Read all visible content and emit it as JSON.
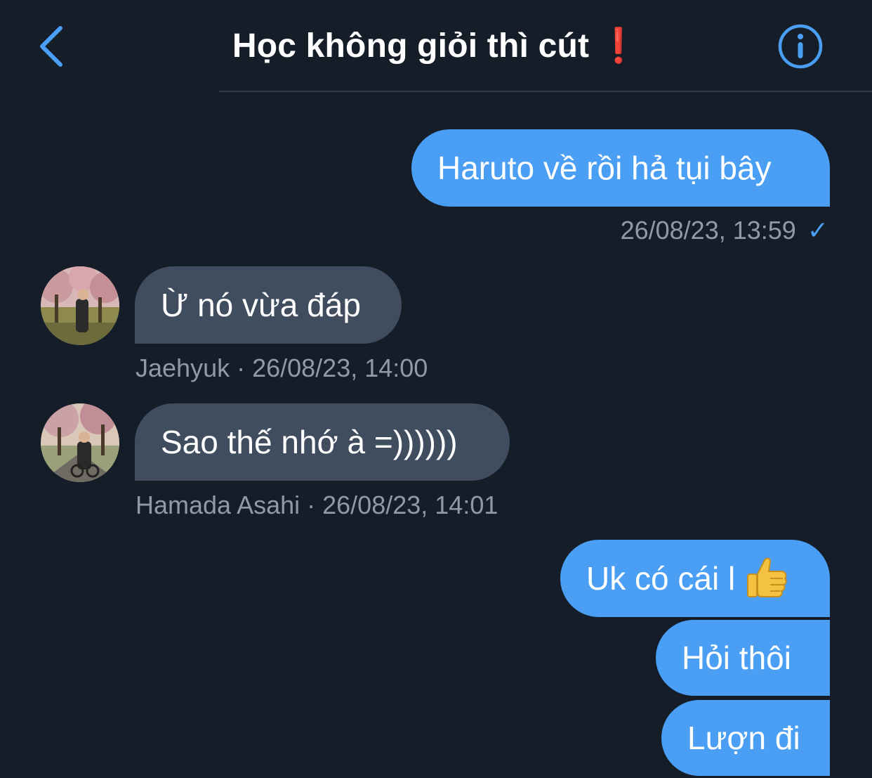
{
  "header": {
    "title": "Học không giỏi thì cút",
    "title_emoji": "❗",
    "back_icon": "chevron-left-icon",
    "info_icon": "info-icon",
    "accent_color": "#4a9ff5"
  },
  "messages": [
    {
      "direction": "outgoing",
      "text": "Haruto về rồi hả tụi bây",
      "meta": "26/08/23, 13:59",
      "status_icon": "✓"
    },
    {
      "direction": "incoming",
      "text": "Ừ nó vừa đáp",
      "meta": "Jaehyuk · 26/08/23, 14:00",
      "avatar": "avatar-jaehyuk"
    },
    {
      "direction": "incoming",
      "text": "Sao thế nhớ à =))))))",
      "meta": "Hamada Asahi · 26/08/23, 14:01",
      "avatar": "avatar-hamada-asahi"
    },
    {
      "direction": "outgoing",
      "text": "Uk có cái l",
      "emoji": "thumbs-up-icon"
    },
    {
      "direction": "outgoing",
      "text": "Hỏi thôi"
    },
    {
      "direction": "outgoing",
      "text": "Lượn đi"
    }
  ],
  "colors": {
    "background": "#151d28",
    "outgoing_bubble": "#4a9ff5",
    "incoming_bubble": "#3f4d5f",
    "meta_text": "#8e9aaa",
    "title_emoji": "#e0242d"
  }
}
